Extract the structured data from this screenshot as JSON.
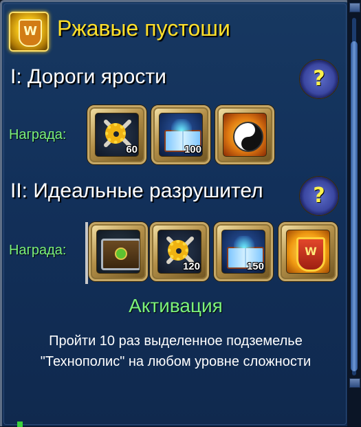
{
  "window": {
    "title": "Ржавые пустоши"
  },
  "quests": [
    {
      "title": "I: Дороги ярости",
      "reward_label": "Награда:",
      "rewards": [
        {
          "icon": "gear-bones-icon",
          "count": "60"
        },
        {
          "icon": "spellbook-icon",
          "count": "100"
        },
        {
          "icon": "yin-yang-icon",
          "count": ""
        }
      ]
    },
    {
      "title": "II: Идеальные разрушител",
      "reward_label": "Награда:",
      "rewards": [
        {
          "icon": "treasure-chest-icon",
          "count": ""
        },
        {
          "icon": "gear-bones-icon",
          "count": "120"
        },
        {
          "icon": "spellbook-icon",
          "count": "150"
        },
        {
          "icon": "emblem-shield-icon",
          "count": ""
        }
      ]
    }
  ],
  "help_label": "?",
  "activation": {
    "heading": "Активация",
    "description": "Пройти 10 раз выделенное подземелье \"Технополис\" на любом уровне сложности"
  },
  "colors": {
    "title": "#ffe02a",
    "reward_label": "#7cf27a",
    "activation": "#7cf27a"
  }
}
